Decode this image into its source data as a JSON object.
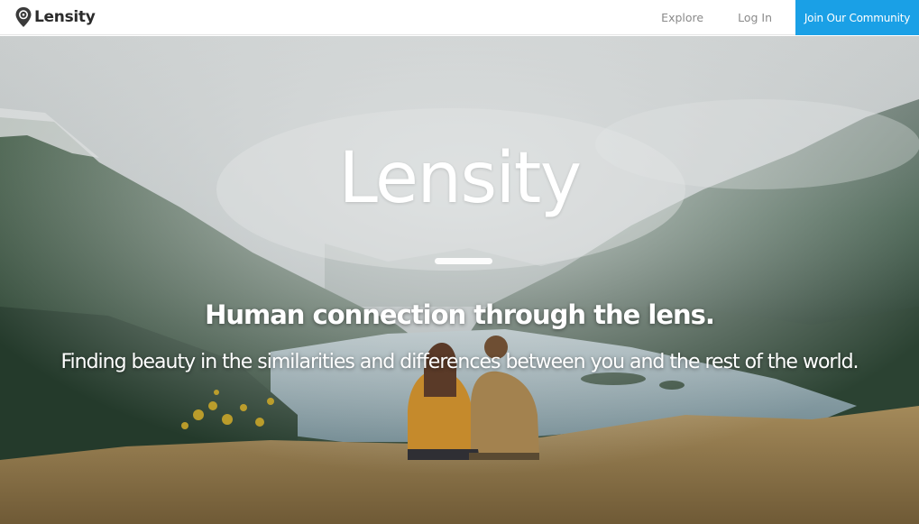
{
  "navbar": {
    "brand": {
      "name": "Lensity",
      "icon": "map-pin-camera-icon"
    },
    "links": {
      "explore": "Explore",
      "login": "Log In",
      "cta": "Join Our Community"
    },
    "colors": {
      "cta_background": "#1aa0e6",
      "link_text": "#8a8a8a",
      "brand_text": "#2b2b2b"
    }
  },
  "hero": {
    "background_description_icon": "landscape-photo",
    "title": "Lensity",
    "tagline": "Human connection through the lens.",
    "subtagline": "Finding beauty in the similarities and differences between you and the rest of the world."
  }
}
